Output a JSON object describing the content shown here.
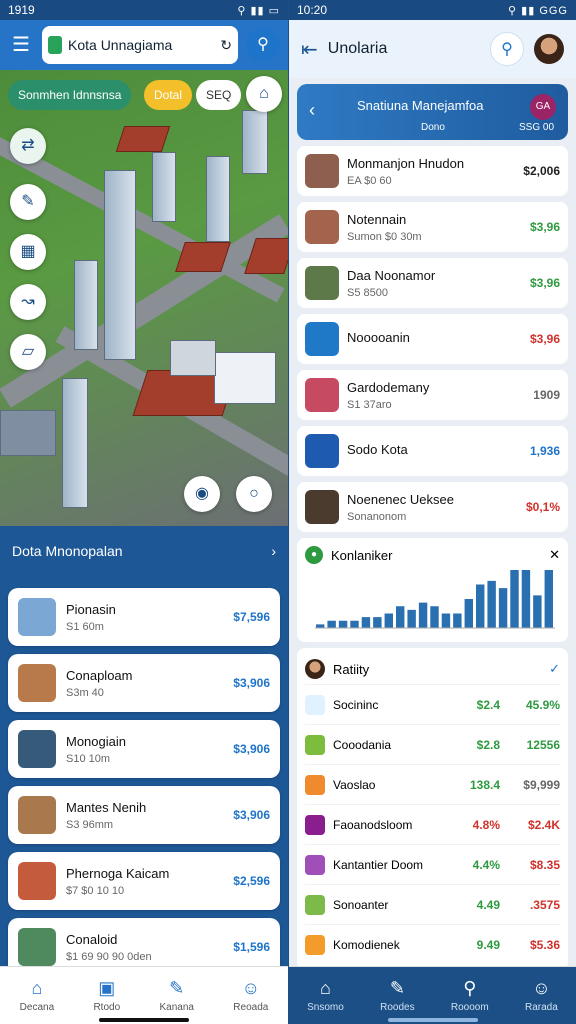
{
  "left": {
    "status": {
      "time": "1919",
      "icons": "⚲ ▮▮ ▭"
    },
    "search": {
      "placeholder": "Kota Unnagiama"
    },
    "chips": {
      "primary": "Sonmhen Idnnsnsa",
      "secondary": "Dotal",
      "third": "SEQ"
    },
    "section": {
      "title": "Dota Mnonopalan"
    },
    "cards": [
      {
        "name": "Pionasin",
        "sub": "S1 60m",
        "price": "$7,596",
        "thumb": "#7aa7d3"
      },
      {
        "name": "Conaploam",
        "sub": "S3m 40",
        "price": "$3,906",
        "thumb": "#b87a4a"
      },
      {
        "name": "Monogiain",
        "sub": "S10 10m",
        "price": "$3,906",
        "thumb": "#365a7a"
      },
      {
        "name": "Mantes Nenih",
        "sub": "S3 96mm",
        "price": "$3,906",
        "thumb": "#a9784d"
      },
      {
        "name": "Phernoga Kaicam",
        "sub": "$7 $0 10 10",
        "price": "$2,596",
        "thumb": "#c55b3d"
      },
      {
        "name": "Conaloid",
        "sub": "$1 69 90 90 0den",
        "price": "$1,596",
        "thumb": "#4e8a5d"
      }
    ],
    "nav": [
      {
        "label": "Decana",
        "icon": "⌂"
      },
      {
        "label": "Rtodo",
        "icon": "▣"
      },
      {
        "label": "Kanana",
        "icon": "✎"
      },
      {
        "label": "Reoada",
        "icon": "☺"
      }
    ]
  },
  "right": {
    "status": {
      "time": "10:20",
      "icons": "⚲ ▮▮ GGG"
    },
    "header": {
      "title": "Unolaria"
    },
    "banner": {
      "title": "Snatiuna Manejamfoa",
      "left": "Dono",
      "right": "SSG 00",
      "badge": "GA"
    },
    "items": [
      {
        "name": "Monmanjon Hnudon",
        "sub": "EA $0 60",
        "price": "$2,006",
        "color": "#222",
        "thumb": "#8e5e4e"
      },
      {
        "name": "Notennain",
        "sub": "Sumon $0 30m",
        "price": "$3,96",
        "color": "#2e9a40",
        "thumb": "#a4634c"
      },
      {
        "name": "Daa Noonamor",
        "sub": "S5 8500",
        "price": "$3,96",
        "color": "#2e9a40",
        "thumb": "#5d7849"
      },
      {
        "name": "Nooooanin",
        "sub": "",
        "price": "$3,96",
        "color": "#d0322c",
        "thumb": "#2079c7"
      },
      {
        "name": "Gardodemany",
        "sub": "S1 37aro",
        "price": "1909",
        "color": "#666",
        "thumb": "#c64a62"
      },
      {
        "name": "Sodo Kota",
        "sub": "",
        "price": "1,936",
        "color": "#1e74c9",
        "thumb": "#1e5bb0"
      },
      {
        "name": "Noenenec Ueksee",
        "sub": "Sonanonom",
        "price": "$0,1%",
        "color": "#d0322c",
        "thumb": "#4b3a2e"
      }
    ],
    "chart": {
      "title": "Konlaniker",
      "type": "bar",
      "values": [
        1,
        2,
        2,
        2,
        3,
        3,
        4,
        6,
        5,
        7,
        6,
        4,
        4,
        8,
        12,
        13,
        11,
        16,
        16,
        9,
        16
      ]
    },
    "ratings": {
      "title": "Ratiity",
      "rows": [
        {
          "label": "Socininc",
          "a": "$2.4",
          "b": "45.9%",
          "ca": "#2e9a40",
          "cb": "#2e9a40",
          "ic": "#e0f1ff"
        },
        {
          "label": "Cooodania",
          "a": "$2.8",
          "b": "12556",
          "ca": "#2e9a40",
          "cb": "#2e9a40",
          "ic": "#7dbd3e"
        },
        {
          "label": "Vaoslao",
          "a": "138.4",
          "b": "$9,999",
          "ca": "#2e9a40",
          "cb": "#666",
          "ic": "#f08a2e"
        },
        {
          "label": "Faoanodsloom",
          "a": "4.8%",
          "b": "$2.4K",
          "ca": "#d0322c",
          "cb": "#d0322c",
          "ic": "#8a1e8f"
        },
        {
          "label": "Kantantier Doom",
          "a": "4.4%",
          "b": "$8.35",
          "ca": "#2e9a40",
          "cb": "#d0322c",
          "ic": "#a04fb8"
        },
        {
          "label": "Sonoanter",
          "a": "4.49",
          "b": ".3575",
          "ca": "#2e9a40",
          "cb": "#d0322c",
          "ic": "#7cbb4a"
        },
        {
          "label": "Komodienek",
          "a": "9.49",
          "b": "$5.36",
          "ca": "#2e9a40",
          "cb": "#d0322c",
          "ic": "#f39c2b"
        }
      ]
    },
    "nav": [
      {
        "label": "Snsomo",
        "icon": "⌂"
      },
      {
        "label": "Roodes",
        "icon": "✎"
      },
      {
        "label": "Roooom",
        "icon": "⚲"
      },
      {
        "label": "Rarada",
        "icon": "☺"
      }
    ]
  }
}
